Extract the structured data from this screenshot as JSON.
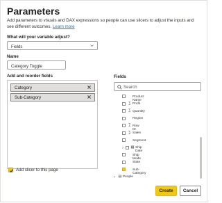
{
  "dialog": {
    "title": "Parameters",
    "description": "Add parameters to visuals and DAX expressions so people can use slicers to adjust the inputs and see different outcomes.",
    "learn_more": "Learn more"
  },
  "variable": {
    "label": "What will your variable adjust?",
    "value": "Fields"
  },
  "name": {
    "label": "Name",
    "value": "Category Toggle"
  },
  "reorder": {
    "label": "Add and reorder fields",
    "items": [
      "Category",
      "Sub-Category"
    ]
  },
  "fields_panel": {
    "label": "Fields",
    "search_placeholder": "Search",
    "rows": [
      {
        "name": "Product Name",
        "icon": "",
        "checked": false,
        "expandable": false,
        "indent": 1
      },
      {
        "name": "Profit",
        "icon": "sigma-icon",
        "checked": false,
        "expandable": false,
        "indent": 1
      },
      {
        "name": "Quantity",
        "icon": "sigma-icon",
        "checked": false,
        "expandable": false,
        "indent": 1
      },
      {
        "name": "Region",
        "icon": "",
        "checked": false,
        "expandable": false,
        "indent": 1
      },
      {
        "name": "Row ID",
        "icon": "sigma-icon",
        "checked": false,
        "expandable": false,
        "indent": 1
      },
      {
        "name": "Sales",
        "icon": "sigma-icon",
        "checked": false,
        "expandable": false,
        "indent": 1
      },
      {
        "name": "Segment",
        "icon": "",
        "checked": false,
        "expandable": false,
        "indent": 1
      },
      {
        "name": "Ship Date",
        "icon": "calendar-icon",
        "checked": false,
        "expandable": true,
        "indent": 1
      },
      {
        "name": "Ship Mode",
        "icon": "",
        "checked": false,
        "expandable": false,
        "indent": 1
      },
      {
        "name": "State",
        "icon": "",
        "checked": false,
        "expandable": false,
        "indent": 1
      },
      {
        "name": "Sub-Category",
        "icon": "",
        "checked": true,
        "expandable": false,
        "indent": 1
      },
      {
        "name": "People",
        "icon": "table-icon",
        "checked": false,
        "expandable": true,
        "indent": 0
      }
    ]
  },
  "add_slicer": {
    "label": "Add slicer to this page",
    "checked": true
  },
  "buttons": {
    "create": "Create",
    "cancel": "Cancel"
  },
  "colors": {
    "accent": "#f2c811",
    "link": "#2b6cb0"
  }
}
